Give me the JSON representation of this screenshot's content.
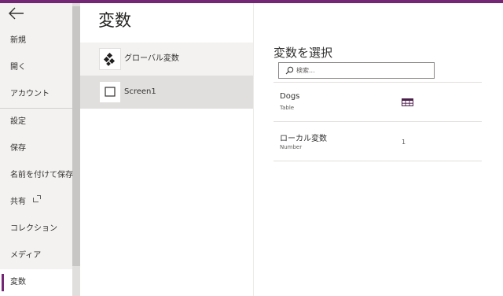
{
  "sidebar": {
    "back_icon": "arrow-left-icon",
    "items": [
      {
        "label": "新規"
      },
      {
        "label": "開く"
      },
      {
        "label": "アカウント"
      },
      {
        "label": "設定"
      },
      {
        "label": "保存"
      },
      {
        "label": "名前を付けて保存"
      },
      {
        "label": "共有"
      },
      {
        "label": "コレクション"
      },
      {
        "label": "メディア"
      },
      {
        "label": "変数"
      }
    ],
    "active_index": 9
  },
  "main": {
    "title": "変数",
    "tree": [
      {
        "label": "グローバル変数",
        "icon": "global-variables-icon",
        "selected": false
      },
      {
        "label": "Screen1",
        "icon": "screen-icon",
        "selected": true
      }
    ]
  },
  "panel": {
    "title": "変数を選択",
    "search": {
      "placeholder": "検索...",
      "value": ""
    },
    "variables": [
      {
        "name": "Dogs",
        "type": "Table",
        "value": "",
        "value_icon": "table-icon"
      },
      {
        "name": "ローカル変数",
        "type": "Number",
        "value": "1"
      }
    ]
  },
  "colors": {
    "accent": "#742774",
    "sidebar_bg": "#f3f2f1",
    "selected_bg": "#e1dfdd"
  }
}
